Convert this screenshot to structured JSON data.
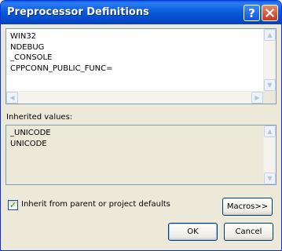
{
  "window": {
    "title": "Preprocessor Definitions",
    "help_glyph": "?",
    "close_glyph": "✕"
  },
  "definitions": {
    "lines": [
      "WIN32",
      "NDEBUG",
      "_CONSOLE",
      "CPPCONN_PUBLIC_FUNC="
    ]
  },
  "inherited": {
    "label": "Inherited values:",
    "lines": [
      "_UNICODE",
      "UNICODE"
    ]
  },
  "inherit_checkbox": {
    "label": "Inherit from parent or project defaults",
    "checked": true,
    "check_glyph": "✓"
  },
  "buttons": {
    "macros": "Macros>>",
    "ok": "OK",
    "cancel": "Cancel"
  },
  "colors": {
    "titlebar": "#0a5ed9",
    "window_bg": "#ece9d8",
    "close_button": "#c7371b"
  }
}
